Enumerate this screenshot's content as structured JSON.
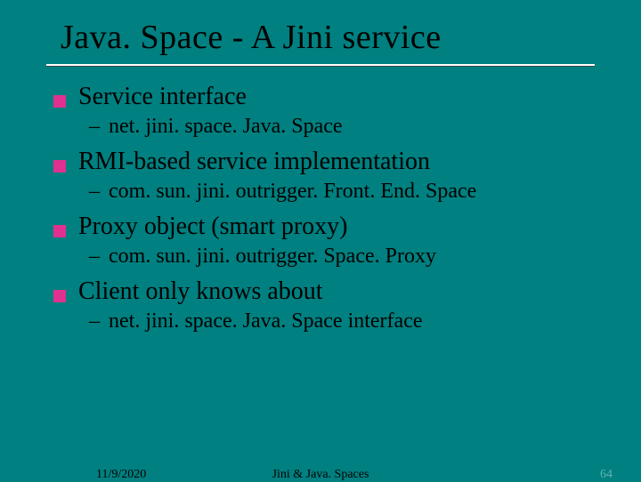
{
  "title": "Java. Space - A Jini service",
  "items": [
    {
      "l1": "Service interface",
      "l2": "net. jini. space. Java. Space"
    },
    {
      "l1": "RMI-based service implementation",
      "l2": "com. sun. jini. outrigger. Front. End. Space"
    },
    {
      "l1": "Proxy object (smart proxy)",
      "l2": "com. sun. jini. outrigger. Space. Proxy"
    },
    {
      "l1": "Client only knows about",
      "l2": "net. jini. space. Java. Space interface"
    }
  ],
  "footer": {
    "left": "11/9/2020",
    "center": "Jini  &  Java. Spaces",
    "right": "64"
  }
}
